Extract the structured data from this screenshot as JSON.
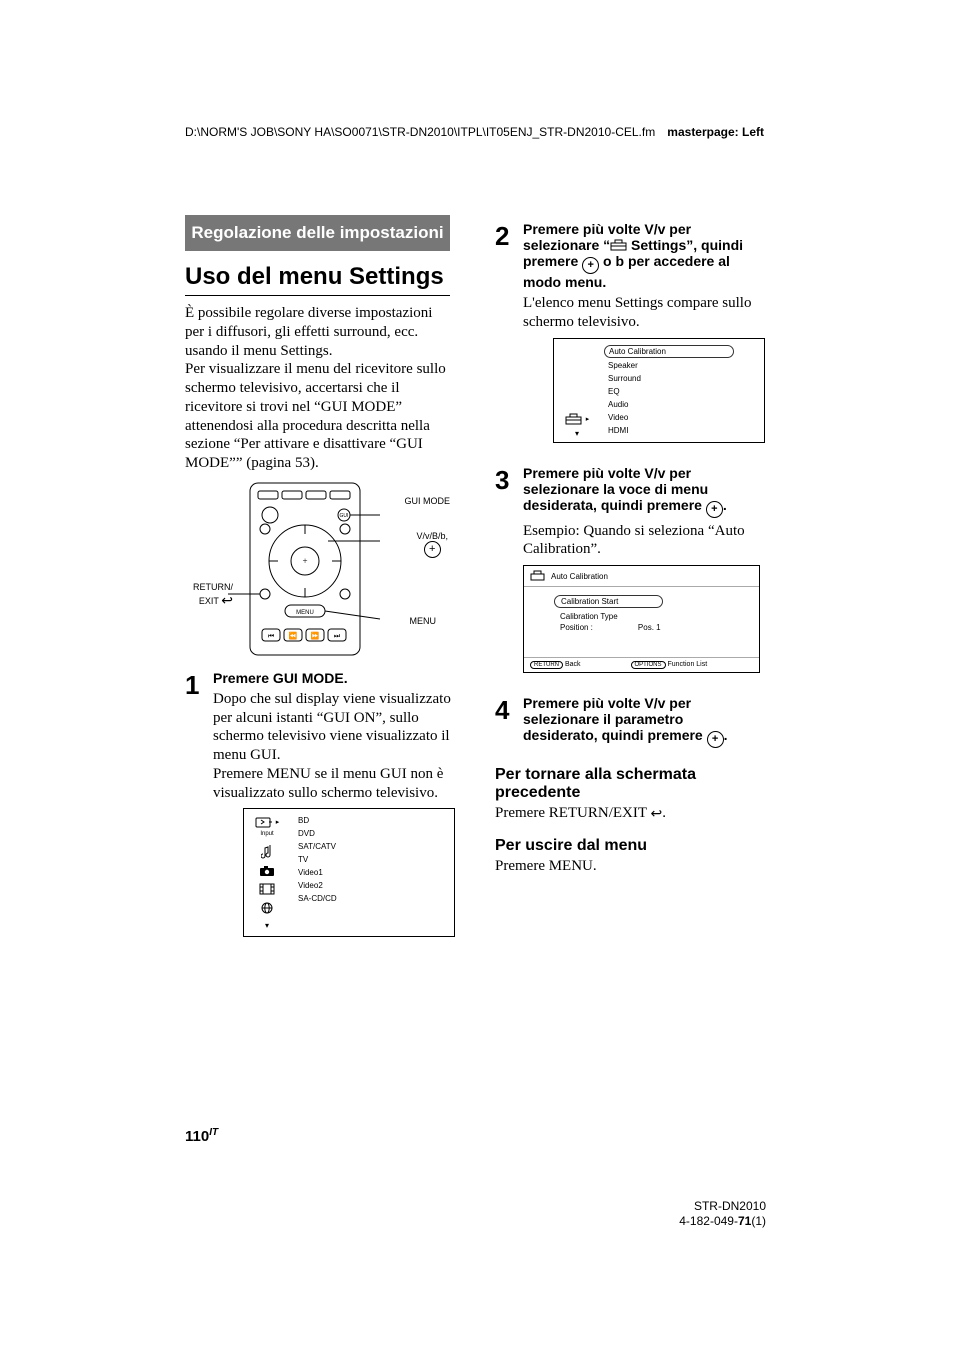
{
  "header": {
    "path_left": "D:\\NORM'S JOB\\SONY HA\\SO0071\\STR-DN2010\\ITPL\\IT05ENJ_STR-DN2010-CEL.fm",
    "path_right": "masterpage: Left"
  },
  "sectionTitle": "Regolazione delle impostazioni",
  "h1": "Uso del menu Settings",
  "intro": "È possibile regolare diverse impostazioni per i diffusori, gli effetti surround, ecc. usando il menu Settings.\nPer visualizzare il menu del ricevitore sullo schermo televisivo, accertarsi che il ricevitore si trovi nel “GUI MODE” attenendosi alla procedura descritta nella sezione “Per attivare e disattivare “GUI MODE”” (pagina 53).",
  "diagram": {
    "left_label_top": "RETURN/",
    "left_label_bot": "EXIT",
    "right_top": "GUI MODE",
    "right_mid_arrows": "▲/▼/◀/►,",
    "right_plus": "+",
    "right_bot": "MENU"
  },
  "steps": [
    {
      "num": "1",
      "title": "Premere GUI MODE.",
      "desc": "Dopo che sul display viene visualizzato per alcuni istanti “GUI ON”, sullo schermo televisivo viene visualizzato il menu GUI.\nPremere MENU se il menu GUI non è visualizzato sullo schermo televisivo."
    },
    {
      "num": "2",
      "title_pre": "Premere più volte ",
      "title_arrows": "↑/↓",
      "title_mid": " per selezionare “",
      "title_settings": " Settings”, quindi premere ",
      "title_or": " o ",
      "title_right_arrow": "→",
      "title_end": " per accedere al modo menu.",
      "desc": "L'elenco menu Settings compare sullo schermo televisivo."
    },
    {
      "num": "3",
      "title_pre": "Premere più volte ",
      "title_arrows": "↑/↓",
      "title_mid": " per selezionare la voce di menu desiderata, quindi premere ",
      "desc": "Esempio: Quando si seleziona “Auto Calibration”."
    },
    {
      "num": "4",
      "title_pre": "Premere più volte ",
      "title_arrows": "↑/↓",
      "title_mid": " per selezionare il parametro desiderato, quindi premere "
    }
  ],
  "inputMenu": {
    "input_label": "Input",
    "items": [
      "BD",
      "DVD",
      "SAT/CATV",
      "TV",
      "Video1",
      "Video2",
      "SA-CD/CD"
    ]
  },
  "settingsMenu": {
    "items": [
      "Auto Calibration",
      "Speaker",
      "Surround",
      "EQ",
      "Audio",
      "Video",
      "HDMI"
    ]
  },
  "autoCal": {
    "title": "Auto Calibration",
    "rows": [
      {
        "label": "Calibration Start",
        "val": ""
      },
      {
        "label": "Calibration Type",
        "val": ""
      },
      {
        "label": "Position :",
        "val": "Pos. 1"
      }
    ],
    "back_key": "RETURN",
    "back_lbl": "Back",
    "opt_key": "OPTIONS",
    "opt_lbl": "Function List"
  },
  "tail": {
    "sub1": "Per tornare alla schermata precedente",
    "sub1_desc_pre": "Premere RETURN/EXIT ",
    "sub2": "Per uscire dal menu",
    "sub2_desc": "Premere MENU."
  },
  "pageNum": "110",
  "pageNumSuffix": "IT",
  "footer": {
    "l1": "STR-DN2010",
    "l2_pre": "4-182-049-",
    "l2_bold": "71",
    "l2_post": "(1)"
  }
}
